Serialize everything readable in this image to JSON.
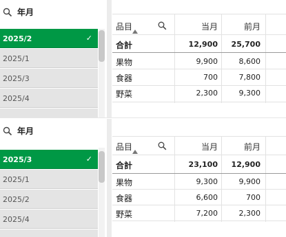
{
  "panels": [
    {
      "filter": {
        "title": "年月",
        "items": [
          {
            "label": "2025/2",
            "selected": true
          },
          {
            "label": "2025/1",
            "selected": false
          },
          {
            "label": "2025/3",
            "selected": false
          },
          {
            "label": "2025/4",
            "selected": false
          }
        ],
        "check": "✓"
      },
      "table": {
        "headers": {
          "dimension": "品目",
          "current": "当月",
          "previous": "前月"
        },
        "total": {
          "label": "合計",
          "current": "12,900",
          "previous": "25,700"
        },
        "rows": [
          {
            "label": "果物",
            "current": "9,900",
            "previous": "8,600"
          },
          {
            "label": "食器",
            "current": "700",
            "previous": "7,800"
          },
          {
            "label": "野菜",
            "current": "2,300",
            "previous": "9,300"
          }
        ]
      }
    },
    {
      "filter": {
        "title": "年月",
        "items": [
          {
            "label": "2025/3",
            "selected": true
          },
          {
            "label": "2025/1",
            "selected": false
          },
          {
            "label": "2025/2",
            "selected": false
          },
          {
            "label": "2025/4",
            "selected": false
          }
        ],
        "check": "✓"
      },
      "table": {
        "headers": {
          "dimension": "品目",
          "current": "当月",
          "previous": "前月"
        },
        "total": {
          "label": "合計",
          "current": "23,100",
          "previous": "12,900"
        },
        "rows": [
          {
            "label": "果物",
            "current": "9,300",
            "previous": "9,900"
          },
          {
            "label": "食器",
            "current": "6,600",
            "previous": "700"
          },
          {
            "label": "野菜",
            "current": "7,200",
            "previous": "2,300"
          }
        ]
      }
    }
  ]
}
